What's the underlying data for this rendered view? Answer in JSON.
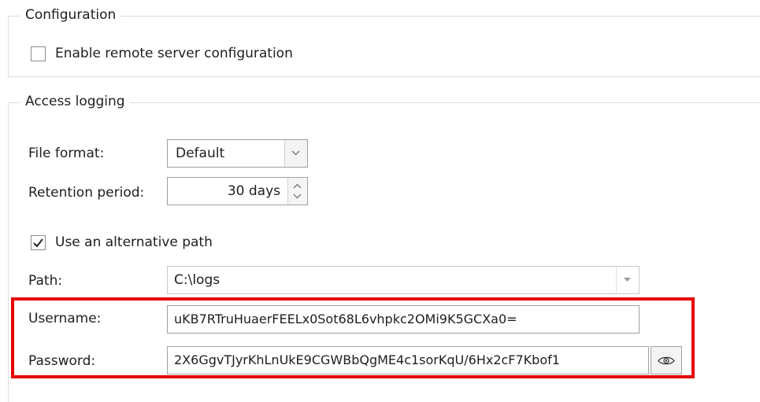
{
  "configuration": {
    "legend": "Configuration",
    "enable_remote_label": "Enable remote server configuration",
    "enable_remote_checked": false
  },
  "access_logging": {
    "legend": "Access logging",
    "file_format": {
      "label": "File format:",
      "value": "Default"
    },
    "retention": {
      "label": "Retention period:",
      "value": "30 days"
    },
    "alt_path": {
      "label": "Use an alternative path",
      "checked": true
    },
    "path": {
      "label": "Path:",
      "value": "C:\\logs"
    },
    "username": {
      "label": "Username:",
      "value": "uKB7RTruHuaerFEELx0Sot68L6vhpkc2OMi9K5GCXa0="
    },
    "password": {
      "label": "Password:",
      "value": "2X6GgvTJyrKhLnUkE9CGWBbQgME4c1sorKqU/6Hx2cF7Kbof1"
    }
  },
  "colors": {
    "highlight": "#e60000"
  }
}
